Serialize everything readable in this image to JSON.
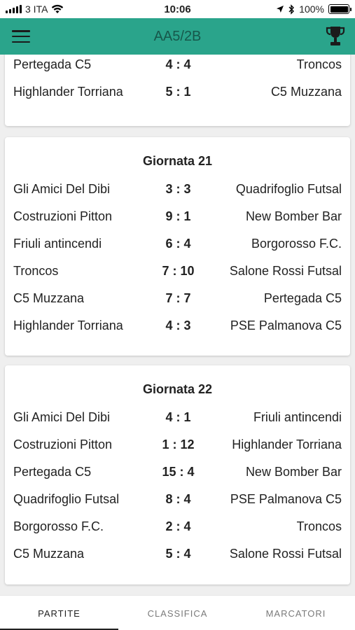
{
  "status_bar": {
    "carrier": "3 ITA",
    "time": "10:06",
    "battery_percent": "100%",
    "battery_level": 1.0
  },
  "header": {
    "title": "AA5/2B",
    "menu_icon": "hamburger-menu-icon",
    "trophy_icon": "trophy-icon"
  },
  "rounds": [
    {
      "title": "",
      "matches": [
        {
          "home": "Pertegada C5",
          "score": "4 : 4",
          "away": "Troncos"
        },
        {
          "home": "Highlander Torriana",
          "score": "5 : 1",
          "away": "C5 Muzzana"
        }
      ]
    },
    {
      "title": "Giornata 21",
      "matches": [
        {
          "home": "Gli Amici Del Dibi",
          "score": "3 : 3",
          "away": "Quadrifoglio Futsal"
        },
        {
          "home": "Costruzioni Pitton",
          "score": "9 : 1",
          "away": "New Bomber Bar"
        },
        {
          "home": "Friuli antincendi",
          "score": "6 : 4",
          "away": "Borgorosso F.C."
        },
        {
          "home": "Troncos",
          "score": "7 : 10",
          "away": "Salone Rossi Futsal"
        },
        {
          "home": "C5 Muzzana",
          "score": "7 : 7",
          "away": "Pertegada C5"
        },
        {
          "home": "Highlander Torriana",
          "score": "4 : 3",
          "away": "PSE Palmanova C5"
        }
      ]
    },
    {
      "title": "Giornata 22",
      "matches": [
        {
          "home": "Gli Amici Del Dibi",
          "score": "4 : 1",
          "away": "Friuli antincendi"
        },
        {
          "home": "Costruzioni Pitton",
          "score": "1 : 12",
          "away": "Highlander Torriana"
        },
        {
          "home": "Pertegada C5",
          "score": "15 : 4",
          "away": "New Bomber Bar"
        },
        {
          "home": "Quadrifoglio Futsal",
          "score": "8 : 4",
          "away": "PSE Palmanova C5"
        },
        {
          "home": "Borgorosso F.C.",
          "score": "2 : 4",
          "away": "Troncos"
        },
        {
          "home": "C5 Muzzana",
          "score": "5 : 4",
          "away": "Salone Rossi Futsal"
        }
      ]
    }
  ],
  "tabs": [
    {
      "label": "PARTITE",
      "active": true
    },
    {
      "label": "CLASSIFICA",
      "active": false
    },
    {
      "label": "MARCATORI",
      "active": false
    }
  ],
  "colors": {
    "app_bar": "#2aa48b",
    "title_text": "#16584b"
  }
}
